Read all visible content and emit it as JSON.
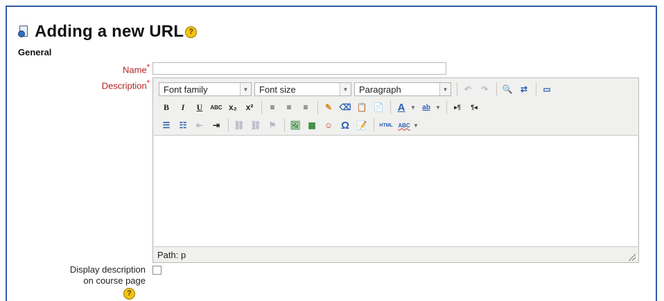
{
  "page": {
    "title": "Adding a new URL",
    "section": "General",
    "help_glyph": "?"
  },
  "form": {
    "name_label": "Name",
    "description_label": "Description",
    "required_mark": "*",
    "name_value": "",
    "display_label_line1": "Display description",
    "display_label_line2": "on course page",
    "display_checked": false
  },
  "editor": {
    "font_family": "Font family",
    "font_size": "Font size",
    "format": "Paragraph",
    "path_text": "Path: p",
    "row2_buttons": [
      {
        "name": "bold-button",
        "glyph": "B"
      },
      {
        "name": "italic-button",
        "glyph": "I"
      },
      {
        "name": "underline-button",
        "glyph": "U"
      },
      {
        "name": "strikethrough-button",
        "glyph": "ABC"
      },
      {
        "name": "subscript-button",
        "glyph": "x₂"
      },
      {
        "name": "superscript-button",
        "glyph": "x²"
      }
    ],
    "icons": {
      "undo": "↶",
      "redo": "↷",
      "find": "🔍",
      "replace": "⇄",
      "fullscreen": "▭",
      "align_left": "≡",
      "align_center": "≡",
      "align_right": "≡",
      "cleanup": "✎",
      "remove_format": "⌫",
      "paste_text": "📋",
      "paste_word": "📄",
      "text_color": "A",
      "highlight": "ab",
      "ltr": "▸¶",
      "rtl": "¶◂",
      "bullets": "☰",
      "numbers": "☷",
      "outdent": "⇤",
      "indent": "⇥",
      "link": "⛓",
      "unlink": "⛓",
      "anchor": "⚑",
      "image": "🖼",
      "media": "▦",
      "emoticon": "☺",
      "special_char": "Ω",
      "edit_table": "📝",
      "html": "HTML",
      "spellcheck": "ABC"
    }
  }
}
